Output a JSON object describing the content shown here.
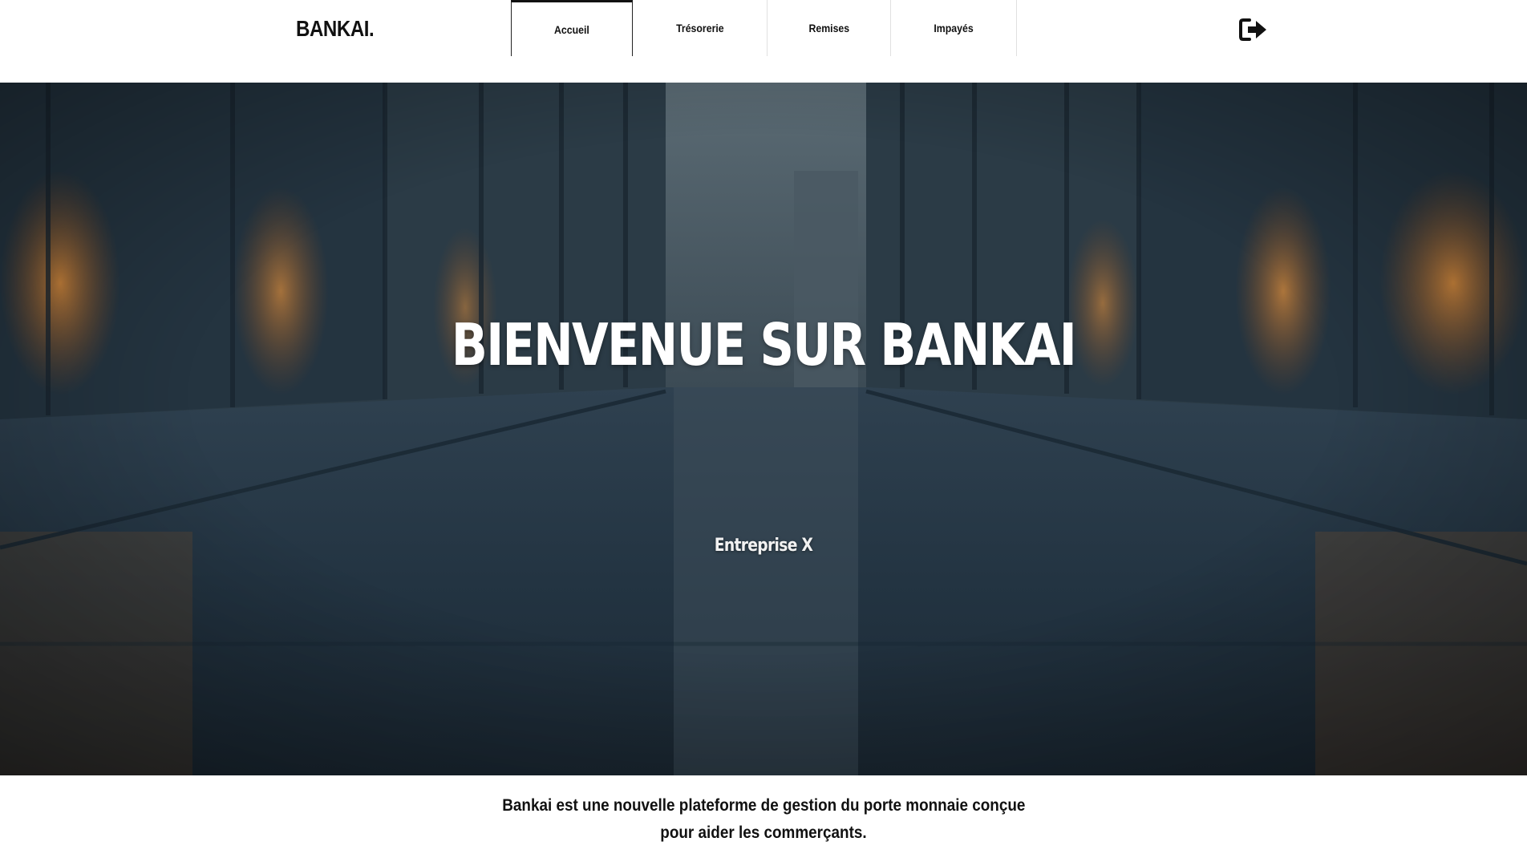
{
  "header": {
    "logo": "BANKAI.",
    "nav": [
      {
        "label": "Accueil",
        "active": true
      },
      {
        "label": "Trésorerie",
        "active": false
      },
      {
        "label": "Remises",
        "active": false
      },
      {
        "label": "Impayés",
        "active": false
      }
    ],
    "logout_icon": "sign-out-icon"
  },
  "hero": {
    "title": "BIENVENUE SUR BANKAI",
    "subtitle": "Entreprise X",
    "background": "glass-corridor-photo"
  },
  "description": {
    "line1": "Bankai est une nouvelle plateforme de gestion du porte monnaie conçue",
    "line2": "pour aider les commerçants."
  },
  "colors": {
    "text": "#111111",
    "hero_text": "#ffffff",
    "accent_warm": "#c8782f",
    "hero_dark": "#22303a"
  }
}
